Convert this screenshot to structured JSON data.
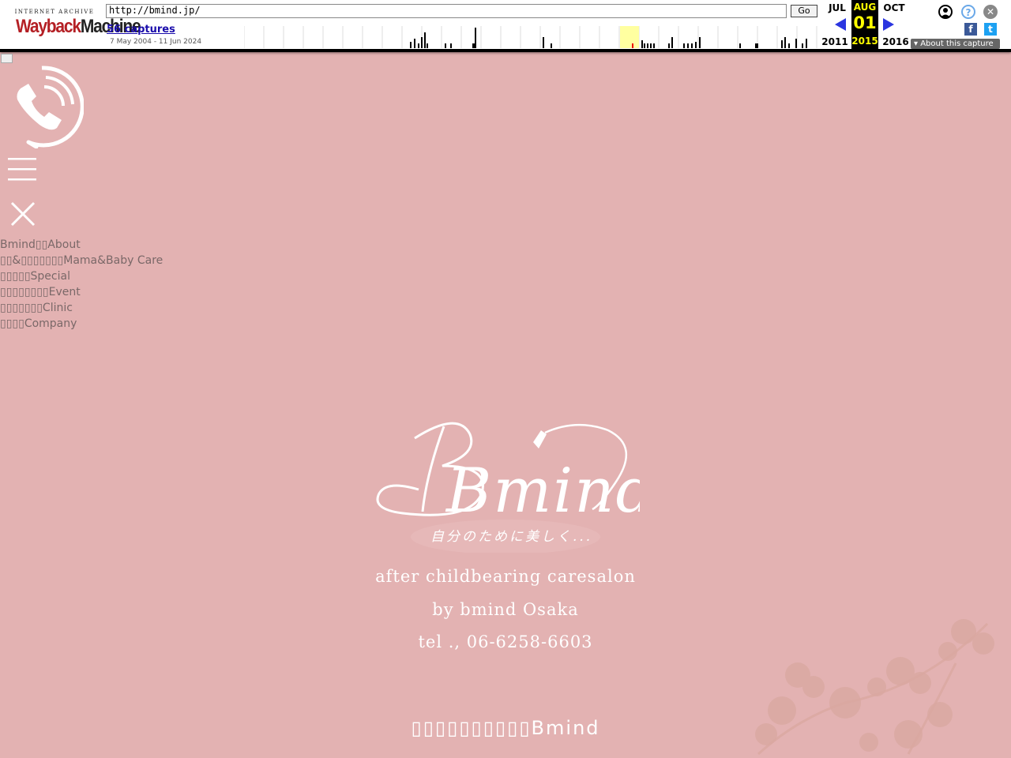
{
  "wayback": {
    "logo_top": "INTERNET ARCHIVE",
    "logo_wayback": "Wayback",
    "logo_machine": "Machine",
    "url": "http://bmind.jp/",
    "go_label": "Go",
    "captures_link": "56 captures",
    "date_range": "7 May 2004 - 11 Jun 2024",
    "prev_month": "JUL",
    "prev_year": "2011",
    "current_month": "AUG",
    "current_day": "01",
    "current_year": "2015",
    "next_month": "OCT",
    "next_year": "2016",
    "about_label": "About this capture",
    "facebook_glyph": "f",
    "twitter_glyph": "t",
    "help_glyph": "?",
    "close_glyph": "✕",
    "accent_color": "#2a35e0",
    "highlight_color": "#ffff00"
  },
  "nav": {
    "items": [
      "Bmind▯▯About",
      "▯▯&▯▯▯▯▯▯▯Mama&Baby Care",
      "▯▯▯▯▯Special",
      "▯▯▯▯▯▯▯▯Event",
      "▯▯▯▯▯▯▯Clinic",
      "▯▯▯▯Company"
    ]
  },
  "hero": {
    "logo_text": "Bmind",
    "logo_subtitle": "自分のために美しく...",
    "line1": "after childbearing caresalon",
    "line2": "by bmind Osaka",
    "line3": "tel ., 06-6258-6603",
    "footer": "▯▯▯▯▯▯▯▯▯▯Bmind"
  },
  "colors": {
    "background": "#e3b2b2",
    "text": "#ffffff",
    "nav_text": "#7a6868"
  }
}
